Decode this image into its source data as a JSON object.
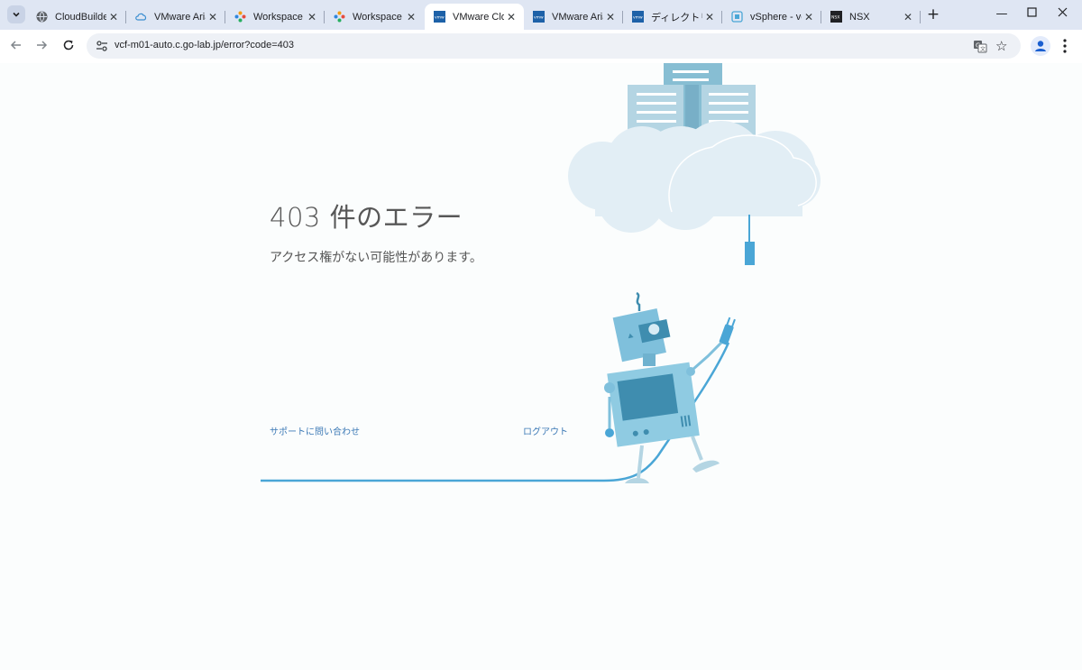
{
  "browser": {
    "tabs": [
      {
        "title": "CloudBuilder",
        "favicon": "globe-icon",
        "active": false
      },
      {
        "title": "VMware Aria",
        "favicon": "cloud-icon",
        "active": false
      },
      {
        "title": "Workspace O",
        "favicon": "workspace-one-icon",
        "active": false
      },
      {
        "title": "Workspace O",
        "favicon": "workspace-one-icon",
        "active": false
      },
      {
        "title": "VMware Clo",
        "favicon": "vmware-icon",
        "active": true
      },
      {
        "title": "VMware Aria",
        "favicon": "vmware-icon",
        "active": false
      },
      {
        "title": "ディレクトリ | V",
        "favicon": "vmware-icon",
        "active": false
      },
      {
        "title": "vSphere - vc",
        "favicon": "vsphere-icon",
        "active": false
      },
      {
        "title": "NSX",
        "favicon": "nsx-icon",
        "active": false
      }
    ],
    "url": "vcf-m01-auto.c.go-lab.jp/error?code=403",
    "colors": {
      "tabstrip": "#dfe6f3",
      "active_tab": "#ffffff",
      "omnibox": "#eef1f6"
    }
  },
  "page": {
    "title": "403 件のエラー",
    "description": "アクセス権がない可能性があります。",
    "links": {
      "support": "サポートに問い合わせ",
      "logout": "ログアウト"
    },
    "colors": {
      "link": "#3d7ab6",
      "cable": "#4aa6d6",
      "cloud": "#dfedf5",
      "robot_body": "#7fc0dc",
      "robot_screen": "#3f8daf"
    }
  }
}
